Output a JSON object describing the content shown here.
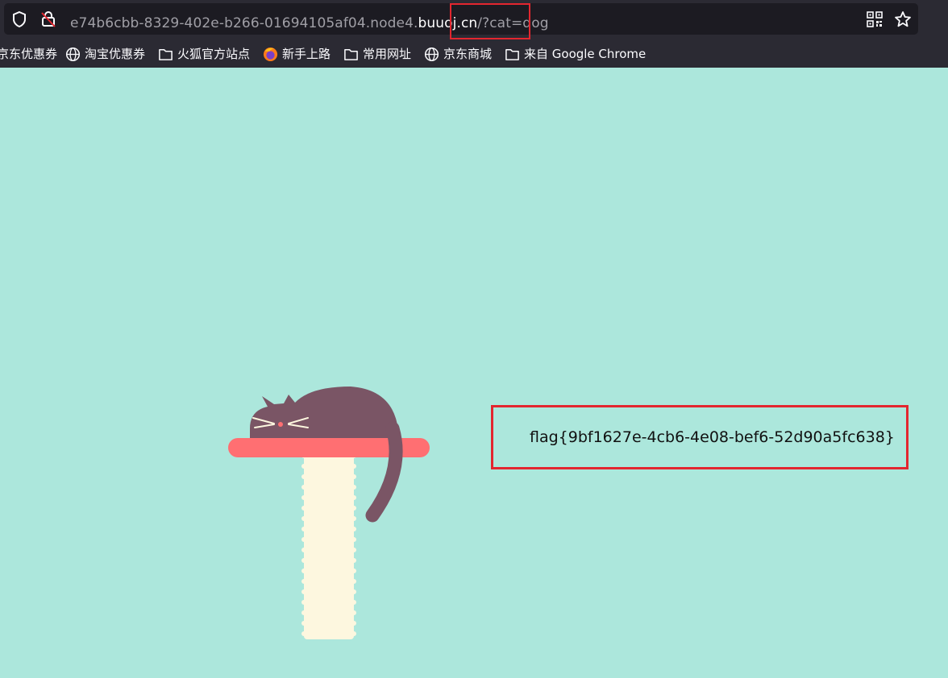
{
  "browser": {
    "url_prefix": "e74b6cbb-8329-402e-b266-01694105af04.node4.",
    "url_domain": "buuoj.cn",
    "url_suffix": "/?cat=dog",
    "bookmarks": [
      {
        "label": "京东优惠券",
        "icon": "globe-icon"
      },
      {
        "label": "淘宝优惠券",
        "icon": "globe-icon"
      },
      {
        "label": "火狐官方站点",
        "icon": "folder-icon"
      },
      {
        "label": "新手上路",
        "icon": "firefox-icon"
      },
      {
        "label": "常用网址",
        "icon": "folder-icon"
      },
      {
        "label": "京东商城",
        "icon": "globe-icon"
      },
      {
        "label": "来自 Google Chrome",
        "icon": "folder-icon"
      }
    ]
  },
  "page": {
    "flag_text": "flag{9bf1627e-4cb6-4e08-bef6-52d90a5fc638}"
  },
  "colors": {
    "page_background": "#ace7dc",
    "highlight_border": "#e3262f",
    "cat": "#7a5565",
    "shelf": "#ff6f72",
    "post": "#fdf7df"
  }
}
